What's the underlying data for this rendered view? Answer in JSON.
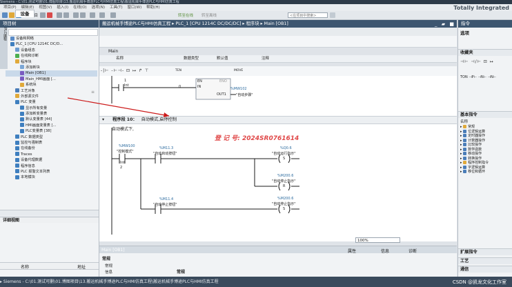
{
  "window": {
    "title": "Siemens - C:\\01.测试可删\\01.博图项目\\13.搬运机械手博途PLC与HMI仿真工程\\搬运机械手博途PLC与HMI仿真工程",
    "brand": "Totally Integrated"
  },
  "menu": [
    "项目(P)",
    "编辑(E)",
    "视图(V)",
    "插入(I)",
    "在线(O)",
    "选项(N)",
    "工具(T)",
    "窗口(W)",
    "帮助(H)"
  ],
  "toolbar": {
    "save_label": "保存项目",
    "go_online": "转至在线",
    "go_offline": "转至离线",
    "search_placeholder": "<在项目中搜索>"
  },
  "project_tree": {
    "title": "项目树",
    "tab": "设备",
    "items": [
      {
        "label": "设备和网络",
        "indent": 1,
        "color": "#5b8cc7"
      },
      {
        "label": "PLC_1 [CPU 1214C DC/D...",
        "indent": 1,
        "color": "#3f7fbf"
      },
      {
        "label": "设备组态",
        "indent": 2,
        "color": "#6b9bd0"
      },
      {
        "label": "在线和诊断",
        "indent": 2,
        "color": "#4caf50"
      },
      {
        "label": "程序块",
        "indent": 2,
        "color": "#e0a93a"
      },
      {
        "label": "添加新块",
        "indent": 3,
        "color": "#7ba7d6"
      },
      {
        "label": "Main [OB1]",
        "indent": 3,
        "color": "#7a5cc1",
        "selected": true
      },
      {
        "label": "Main_HMI画面 [...",
        "indent": 3,
        "color": "#7a5cc1"
      },
      {
        "label": "系统块",
        "indent": 3,
        "color": "#e0a93a"
      },
      {
        "label": "工艺对象",
        "indent": 2,
        "color": "#4a7db8"
      },
      {
        "label": "外部源文件",
        "indent": 2,
        "color": "#e0a93a"
      },
      {
        "label": "PLC 变量",
        "indent": 2,
        "color": "#3f7fbf"
      },
      {
        "label": "显示所有变量",
        "indent": 3,
        "color": "#3f7fbf"
      },
      {
        "label": "添加新变量表",
        "indent": 3,
        "color": "#3f7fbf"
      },
      {
        "label": "默认变量表 [44]",
        "indent": 3,
        "color": "#3f7fbf"
      },
      {
        "label": "HMI画面变量表 [...",
        "indent": 3,
        "color": "#3f7fbf"
      },
      {
        "label": "PLC变量表 [38]",
        "indent": 3,
        "color": "#3f7fbf"
      },
      {
        "label": "PLC 数据类型",
        "indent": 2,
        "color": "#3f7fbf"
      },
      {
        "label": "监控与强制表",
        "indent": 2,
        "color": "#3f7fbf"
      },
      {
        "label": "在线备份",
        "indent": 2,
        "color": "#3f7fbf"
      },
      {
        "label": "Traces",
        "indent": 2,
        "color": "#3f7fbf"
      },
      {
        "label": "设备代理数据",
        "indent": 2,
        "color": "#3f7fbf"
      },
      {
        "label": "程序信息",
        "indent": 2,
        "color": "#3f7fbf"
      },
      {
        "label": "PLC 报警文本列表",
        "indent": 2,
        "color": "#3f7fbf"
      },
      {
        "label": "本地模块",
        "indent": 2,
        "color": "#3f7fbf"
      }
    ],
    "details_view": "详细视图",
    "details_cols": [
      "名称",
      "地址"
    ]
  },
  "editor": {
    "breadcrumb": "搬运机械手博途PLC与HMI仿真工程 ▸ PLC_1 [CPU 1214C DC/DC/DC] ▸ 程序块 ▸ Main [OB1]",
    "block_name": "Main",
    "interface_cols": [
      "名称",
      "数据类型",
      "默认值",
      "注释"
    ],
    "ladder_tools": [
      "TEN",
      "MOVE"
    ],
    "upper": {
      "en": "EN",
      "eno": "ENO",
      "contact_addr": "Int",
      "line_no": "1",
      "in_label": "IN",
      "in_value": "0",
      "out_label": "OUT1",
      "out_addr": "%MW102",
      "out_comment": "\"自动步骤\""
    },
    "segment": {
      "title": "程序段 10：",
      "title_desc": "自动模式,启停控制",
      "comment": "自动模式下,",
      "watermark": "登 记 号: 2024SR0761614"
    },
    "rungs": {
      "c1_addr": "%MW100",
      "c1_name": "\"控制模式\"",
      "c1_type": "Int",
      "c1_value": "2",
      "c2_addr": "%M11.3",
      "c2_name": "\"自动启动按钮\"",
      "c3_addr": "%M11.4",
      "c3_name": "\"自动停止按钮\"",
      "q1_addr": "%Q0.6",
      "q1_name": "\"自动运行指示\"",
      "q1_coil": "S",
      "q2_addr": "%M200.6",
      "q2_name": "\"自动停止指示\"",
      "q2_coil": "R",
      "q3_addr": "%M200.6",
      "q3_name": "\"自动停止指示\"",
      "q3_coil": "S"
    },
    "zoom": "100%",
    "status_tab": "Main [OB1]",
    "status_tabs": [
      "属性",
      "信息",
      "诊断"
    ]
  },
  "inspector": {
    "tab": "常规",
    "items": [
      "常规",
      "信息"
    ],
    "heading": "常规"
  },
  "right_panel": {
    "title": "指令",
    "options_label": "选项",
    "favorites": "收藏夹",
    "basic_instructions": "基本指令",
    "name_col": "名称",
    "groups": [
      {
        "label": "常规",
        "color": "#e0a93a"
      },
      {
        "label": "位逻辑运算",
        "color": "#4a7db8"
      },
      {
        "label": "定时器操作",
        "color": "#4a7db8"
      },
      {
        "label": "计数器操作",
        "color": "#4a7db8"
      },
      {
        "label": "比较操作",
        "color": "#4a7db8"
      },
      {
        "label": "数学函数",
        "color": "#4a7db8"
      },
      {
        "label": "移动操作",
        "color": "#4a7db8"
      },
      {
        "label": "转换操作",
        "color": "#4a7db8"
      },
      {
        "label": "程序控制指令",
        "color": "#e0a93a"
      },
      {
        "label": "字逻辑运算",
        "color": "#4a7db8"
      },
      {
        "label": "移位和循环",
        "color": "#4a7db8"
      }
    ],
    "extended": "扩展指令",
    "technology": "工艺",
    "communication": "通信"
  },
  "taskbar": {
    "text": "▸ Siemens - C:\\01.测试可删\\01.博图项目\\13.搬运机械手博途PLC与HMI仿真工程\\搬运机械手博途PLC与HMI仿真工程",
    "credit": "CSDN @凯龙文化工作室"
  },
  "colors": {
    "accent_dark": "#3d5670",
    "watermark": "#e04848",
    "annotation": "#cc1a1a"
  }
}
